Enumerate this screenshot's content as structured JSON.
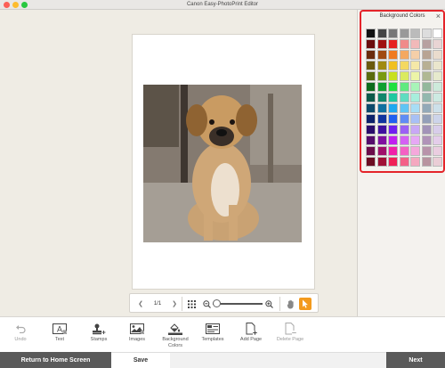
{
  "window": {
    "title": "Canon Easy-PhotoPrint Editor"
  },
  "navbar": {
    "page_indicator": "1/1"
  },
  "background_panel": {
    "title": "Background Colors",
    "swatches": [
      [
        "#111111",
        "#444444",
        "#777777",
        "#999999",
        "#bbbbbb",
        "#dddddd",
        "#ffffff"
      ],
      [
        "#6b0d0d",
        "#a01010",
        "#e62020",
        "#f08a8a",
        "#f2b9b9",
        "#b7a0a0",
        "#e9d4d4"
      ],
      [
        "#6b2c0d",
        "#a04a10",
        "#f07a20",
        "#f4a860",
        "#f5cfa8",
        "#b8a493",
        "#eadccd"
      ],
      [
        "#6b5a0d",
        "#a08a10",
        "#f0c020",
        "#f4d860",
        "#f5e8a8",
        "#b8b093",
        "#eae6cd"
      ],
      [
        "#5a6b0d",
        "#7a9a10",
        "#c8e020",
        "#daea60",
        "#ecf4a8",
        "#b0b893",
        "#e6eacd"
      ],
      [
        "#0d6b1c",
        "#10a030",
        "#20e040",
        "#60ea80",
        "#a8f4b8",
        "#93b89c",
        "#cdeadb"
      ],
      [
        "#0d5a4a",
        "#10876b",
        "#20c8a0",
        "#60dcc0",
        "#a8eedc",
        "#93b8ae",
        "#cdeae2"
      ],
      [
        "#0d4a6b",
        "#1070a0",
        "#20a8f0",
        "#60c4f4",
        "#a8ddf5",
        "#93a9b8",
        "#cde0ea"
      ],
      [
        "#0d226b",
        "#1034a0",
        "#2060f0",
        "#608cf4",
        "#a8c0f5",
        "#939fb8",
        "#cdd4ea"
      ],
      [
        "#2a0d6b",
        "#4010a0",
        "#7020f0",
        "#9c60f4",
        "#c8a8f5",
        "#a293b8",
        "#d8cdea"
      ],
      [
        "#550d6b",
        "#8010a0",
        "#c020f0",
        "#d460f4",
        "#e6a8f5",
        "#b093b8",
        "#e4cdea"
      ],
      [
        "#6b0d4a",
        "#a0106a",
        "#f020a8",
        "#f460c4",
        "#f5a8dc",
        "#b893aa",
        "#eacde0"
      ],
      [
        "#6b0d22",
        "#a01036",
        "#f02058",
        "#f46088",
        "#f5a8c0",
        "#b893a0",
        "#eacdd6"
      ]
    ]
  },
  "toolbar": {
    "items": [
      {
        "label": "Undo",
        "icon": "undo-icon"
      },
      {
        "label": "Text",
        "icon": "text-icon"
      },
      {
        "label": "Stamps",
        "icon": "stamps-icon"
      },
      {
        "label": "Images",
        "icon": "images-icon"
      },
      {
        "label": "Background Colors",
        "icon": "background-colors-icon"
      },
      {
        "label": "Templates",
        "icon": "templates-icon"
      },
      {
        "label": "Add Page",
        "icon": "add-page-icon"
      },
      {
        "label": "Delete Page",
        "icon": "delete-page-icon"
      }
    ]
  },
  "bottom": {
    "home_label": "Return to Home Screen",
    "save_label": "Save",
    "next_label": "Next"
  }
}
